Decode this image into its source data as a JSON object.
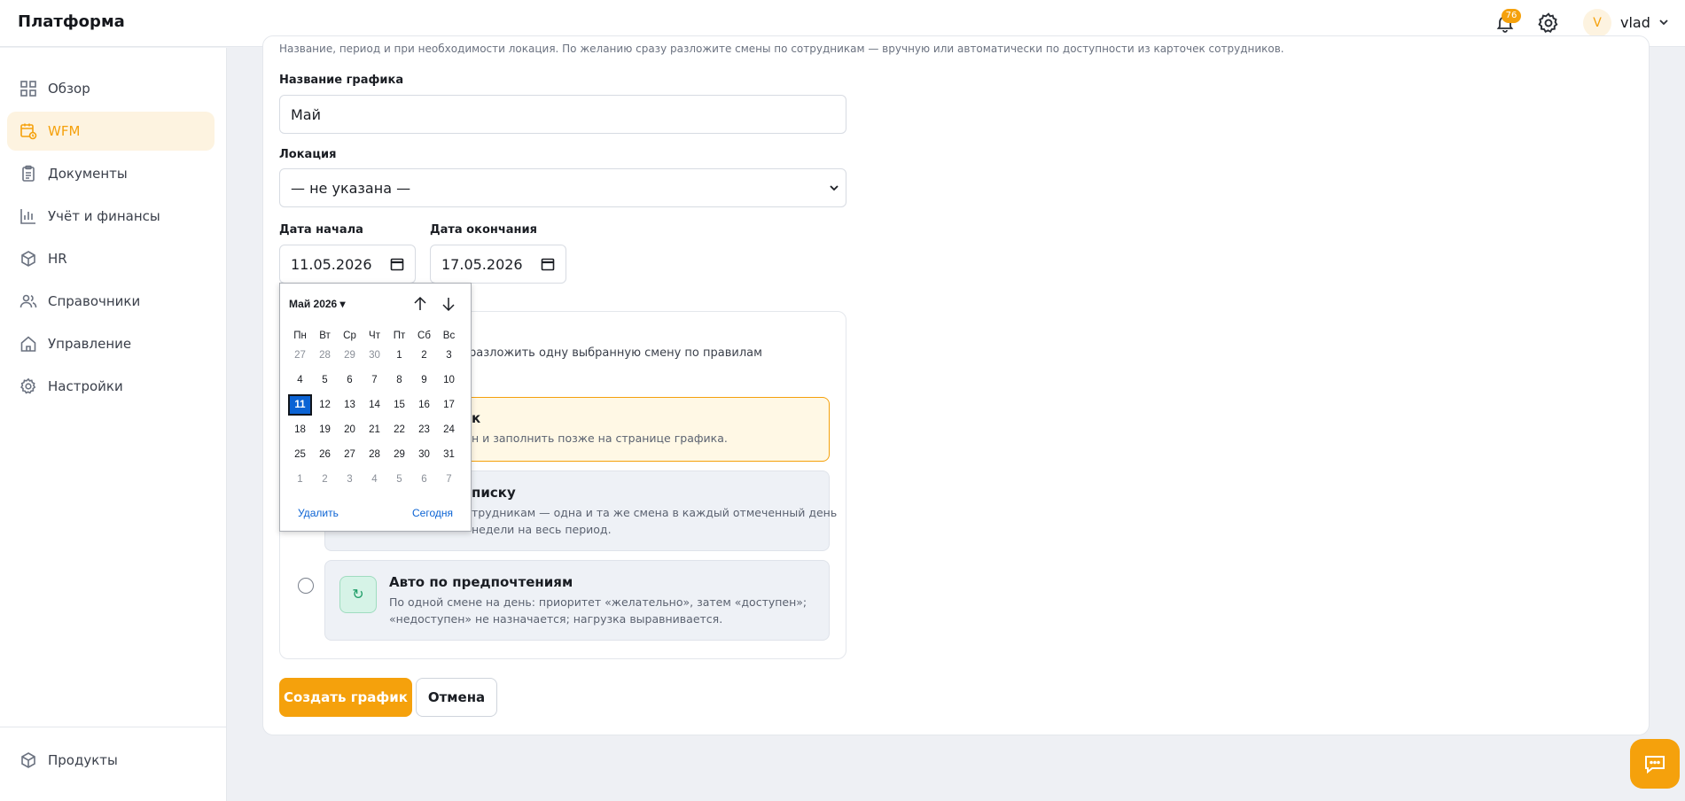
{
  "app": {
    "title": "Платформа"
  },
  "header": {
    "notifications_count": "76",
    "user_initial": "V",
    "username": "vlad"
  },
  "sidebar": {
    "items": [
      {
        "label": "Обзор",
        "icon": "grid-icon"
      },
      {
        "label": "WFM",
        "icon": "calendar-clock-icon",
        "active": true
      },
      {
        "label": "Документы",
        "icon": "clipboard-icon"
      },
      {
        "label": "Учёт и финансы",
        "icon": "bar-chart-icon"
      },
      {
        "label": "HR",
        "icon": "cube-icon"
      },
      {
        "label": "Справочники",
        "icon": "users-icon"
      },
      {
        "label": "Управление",
        "icon": "home-icon"
      },
      {
        "label": "Настройки",
        "icon": "gear-icon"
      }
    ],
    "footer_item": {
      "label": "Продукты",
      "icon": "cube-icon"
    }
  },
  "form": {
    "hint": "Название, период и при необходимости локация. По желанию сразу разложите смены по сотрудникам — вручную или автоматически по доступности из карточек сотрудников.",
    "name_label": "Название графика",
    "name_value": "Май",
    "location_label": "Локация",
    "location_value": "— не указана —",
    "start_label": "Дата начала",
    "start_value": "11.05.2026",
    "end_label": "Дата окончания",
    "end_value": "17.05.2026",
    "mode_desc_partial": "и или сразу разложить одну выбранную смену по правилам",
    "options": [
      {
        "title_partial": "к",
        "text_partial": "н и заполнить позже на странице графика."
      },
      {
        "title_partial": "писку",
        "text_line1_partial": "трудникам — одна и та же смена в каждый отмеченный день",
        "text_line2_partial": "недели на весь период."
      },
      {
        "title": "Авто по предпочтениям",
        "text_line1": "По одной смене на день: приоритет «желательно», затем «доступен»;",
        "text_line2": "«недоступен» не назначается; нагрузка выравнивается."
      }
    ],
    "submit_label": "Создать график",
    "cancel_label": "Отмена"
  },
  "datepicker": {
    "month_label": "Май 2026 ▾",
    "weekdays": [
      "Пн",
      "Вт",
      "Ср",
      "Чт",
      "Пт",
      "Сб",
      "Вс"
    ],
    "weeks": [
      [
        "27",
        "28",
        "29",
        "30",
        "1",
        "2",
        "3"
      ],
      [
        "4",
        "5",
        "6",
        "7",
        "8",
        "9",
        "10"
      ],
      [
        "11",
        "12",
        "13",
        "14",
        "15",
        "16",
        "17"
      ],
      [
        "18",
        "19",
        "20",
        "21",
        "22",
        "23",
        "24"
      ],
      [
        "25",
        "26",
        "27",
        "28",
        "29",
        "30",
        "31"
      ],
      [
        "1",
        "2",
        "3",
        "4",
        "5",
        "6",
        "7"
      ]
    ],
    "selected_day": "11",
    "clear_label": "Удалить",
    "today_label": "Сегодня"
  },
  "colors": {
    "accent": "#f5a10c",
    "link": "#0b63d4",
    "selected_day": "#0b63d4"
  }
}
